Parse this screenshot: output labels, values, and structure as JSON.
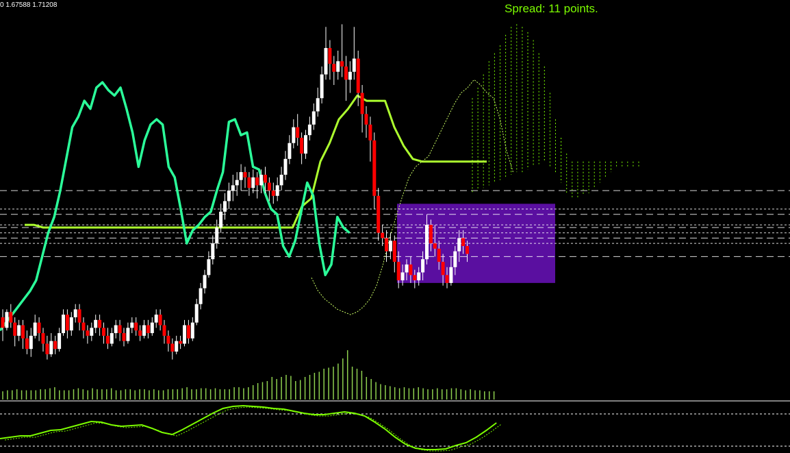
{
  "header": {
    "ohlc_readout": "0 1.67588 1.71208",
    "spread_text": "Spread: 11 points."
  },
  "colors": {
    "background": "#000000",
    "bull_candle": "#ffffff",
    "bear_candle": "#ff0000",
    "wick": "#ffffff",
    "tenkan": "#2bff9a",
    "kijun": "#adff2f",
    "chikou": "#ccff66",
    "cloud": "#7cfc00",
    "levels": "#ffffff",
    "zone_fill": "#5a0fa0",
    "volume": "#8fd14f",
    "oscillator": "#7cfc00",
    "spread_text": "#7cfc00"
  },
  "chart_data": [
    {
      "type": "candlestick",
      "candles_ohlc": [
        [
          1.665,
          1.661,
          1.668,
          1.656
        ],
        [
          1.661,
          1.667,
          1.668,
          1.66
        ],
        [
          1.667,
          1.663,
          1.67,
          1.661
        ],
        [
          1.663,
          1.658,
          1.665,
          1.654
        ],
        [
          1.658,
          1.662,
          1.664,
          1.656
        ],
        [
          1.662,
          1.657,
          1.664,
          1.653
        ],
        [
          1.657,
          1.653,
          1.66,
          1.651
        ],
        [
          1.653,
          1.658,
          1.661,
          1.65
        ],
        [
          1.658,
          1.663,
          1.666,
          1.657
        ],
        [
          1.663,
          1.659,
          1.665,
          1.656
        ],
        [
          1.659,
          1.655,
          1.661,
          1.652
        ],
        [
          1.655,
          1.651,
          1.658,
          1.649
        ],
        [
          1.651,
          1.656,
          1.659,
          1.65
        ],
        [
          1.656,
          1.653,
          1.658,
          1.651
        ],
        [
          1.653,
          1.659,
          1.661,
          1.652
        ],
        [
          1.659,
          1.666,
          1.668,
          1.658
        ],
        [
          1.666,
          1.66,
          1.668,
          1.657
        ],
        [
          1.66,
          1.665,
          1.667,
          1.658
        ],
        [
          1.665,
          1.668,
          1.67,
          1.663
        ],
        [
          1.668,
          1.663,
          1.67,
          1.66
        ],
        [
          1.663,
          1.66,
          1.665,
          1.657
        ],
        [
          1.66,
          1.658,
          1.662,
          1.655
        ],
        [
          1.658,
          1.661,
          1.663,
          1.656
        ],
        [
          1.661,
          1.664,
          1.666,
          1.659
        ],
        [
          1.664,
          1.661,
          1.666,
          1.658
        ],
        [
          1.661,
          1.658,
          1.663,
          1.655
        ],
        [
          1.658,
          1.655,
          1.661,
          1.653
        ],
        [
          1.655,
          1.659,
          1.661,
          1.654
        ],
        [
          1.659,
          1.662,
          1.664,
          1.657
        ],
        [
          1.662,
          1.659,
          1.664,
          1.656
        ],
        [
          1.659,
          1.656,
          1.661,
          1.654
        ],
        [
          1.656,
          1.661,
          1.663,
          1.655
        ],
        [
          1.661,
          1.663,
          1.665,
          1.659
        ],
        [
          1.663,
          1.66,
          1.665,
          1.658
        ],
        [
          1.66,
          1.658,
          1.662,
          1.656
        ],
        [
          1.658,
          1.662,
          1.664,
          1.657
        ],
        [
          1.662,
          1.659,
          1.664,
          1.657
        ],
        [
          1.659,
          1.663,
          1.665,
          1.658
        ],
        [
          1.663,
          1.666,
          1.668,
          1.661
        ],
        [
          1.666,
          1.662,
          1.668,
          1.66
        ],
        [
          1.662,
          1.658,
          1.664,
          1.655
        ],
        [
          1.658,
          1.655,
          1.66,
          1.652
        ],
        [
          1.655,
          1.652,
          1.657,
          1.649
        ],
        [
          1.652,
          1.656,
          1.658,
          1.651
        ],
        [
          1.656,
          1.655,
          1.658,
          1.653
        ],
        [
          1.655,
          1.662,
          1.664,
          1.654
        ],
        [
          1.662,
          1.657,
          1.664,
          1.655
        ],
        [
          1.657,
          1.663,
          1.665,
          1.656
        ],
        [
          1.663,
          1.67,
          1.672,
          1.662
        ],
        [
          1.67,
          1.676,
          1.678,
          1.668
        ],
        [
          1.676,
          1.681,
          1.683,
          1.674
        ],
        [
          1.681,
          1.687,
          1.69,
          1.68
        ],
        [
          1.687,
          1.693,
          1.696,
          1.685
        ],
        [
          1.693,
          1.699,
          1.702,
          1.691
        ],
        [
          1.699,
          1.705,
          1.708,
          1.697
        ],
        [
          1.705,
          1.709,
          1.712,
          1.702
        ],
        [
          1.709,
          1.713,
          1.716,
          1.706
        ],
        [
          1.713,
          1.715,
          1.719,
          1.709
        ],
        [
          1.715,
          1.717,
          1.72,
          1.711
        ],
        [
          1.717,
          1.72,
          1.723,
          1.713
        ],
        [
          1.72,
          1.718,
          1.722,
          1.714
        ],
        [
          1.718,
          1.714,
          1.72,
          1.711
        ],
        [
          1.714,
          1.718,
          1.721,
          1.712
        ],
        [
          1.718,
          1.715,
          1.72,
          1.71
        ],
        [
          1.715,
          1.719,
          1.721,
          1.712
        ],
        [
          1.719,
          1.716,
          1.722,
          1.712
        ],
        [
          1.716,
          1.713,
          1.718,
          1.709
        ],
        [
          1.713,
          1.711,
          1.716,
          1.708
        ],
        [
          1.711,
          1.715,
          1.718,
          1.709
        ],
        [
          1.715,
          1.719,
          1.722,
          1.713
        ],
        [
          1.719,
          1.725,
          1.728,
          1.717
        ],
        [
          1.725,
          1.731,
          1.734,
          1.723
        ],
        [
          1.731,
          1.737,
          1.74,
          1.729
        ],
        [
          1.737,
          1.733,
          1.742,
          1.73
        ],
        [
          1.733,
          1.727,
          1.735,
          1.723
        ],
        [
          1.727,
          1.734,
          1.736,
          1.725
        ],
        [
          1.734,
          1.738,
          1.741,
          1.732
        ],
        [
          1.738,
          1.743,
          1.746,
          1.736
        ],
        [
          1.743,
          1.748,
          1.752,
          1.741
        ],
        [
          1.748,
          1.757,
          1.76,
          1.746
        ],
        [
          1.757,
          1.767,
          1.775,
          1.755
        ],
        [
          1.767,
          1.761,
          1.77,
          1.755
        ],
        [
          1.761,
          1.758,
          1.764,
          1.753
        ],
        [
          1.758,
          1.762,
          1.766,
          1.755
        ],
        [
          1.762,
          1.76,
          1.776,
          1.756
        ],
        [
          1.76,
          1.755,
          1.764,
          1.747
        ],
        [
          1.755,
          1.758,
          1.762,
          1.75
        ],
        [
          1.758,
          1.763,
          1.775,
          1.755
        ],
        [
          1.763,
          1.75,
          1.766,
          1.745
        ],
        [
          1.75,
          1.742,
          1.753,
          1.735
        ],
        [
          1.742,
          1.738,
          1.745,
          1.733
        ],
        [
          1.738,
          1.732,
          1.741,
          1.724
        ],
        [
          1.732,
          1.711,
          1.735,
          1.706
        ],
        [
          1.711,
          1.697,
          1.714,
          1.694
        ],
        [
          1.697,
          1.695,
          1.7,
          1.692
        ],
        [
          1.695,
          1.69,
          1.698,
          1.686
        ],
        [
          1.69,
          1.694,
          1.697,
          1.687
        ],
        [
          1.694,
          1.686,
          1.696,
          1.682
        ],
        [
          1.686,
          1.679,
          1.69,
          1.676
        ],
        [
          1.679,
          1.682,
          1.685,
          1.677
        ],
        [
          1.682,
          1.685,
          1.687,
          1.679
        ],
        [
          1.685,
          1.681,
          1.688,
          1.678
        ],
        [
          1.681,
          1.679,
          1.683,
          1.676
        ],
        [
          1.679,
          1.682,
          1.684,
          1.677
        ],
        [
          1.682,
          1.687,
          1.69,
          1.679
        ],
        [
          1.687,
          1.7,
          1.704,
          1.685
        ],
        [
          1.7,
          1.693,
          1.702,
          1.69
        ],
        [
          1.693,
          1.691,
          1.7,
          1.688
        ],
        [
          1.691,
          1.686,
          1.694,
          1.683
        ],
        [
          1.686,
          1.681,
          1.689,
          1.677
        ],
        [
          1.681,
          1.678,
          1.684,
          1.676
        ],
        [
          1.678,
          1.684,
          1.688,
          1.677
        ],
        [
          1.684,
          1.69,
          1.692,
          1.681
        ],
        [
          1.69,
          1.695,
          1.698,
          1.686
        ],
        [
          1.695,
          1.692,
          1.698,
          1.689
        ],
        [
          1.692,
          1.689,
          1.694,
          1.686
        ]
      ],
      "ichimoku": {
        "tenkan": [
          1.66,
          1.663,
          1.666,
          1.669,
          1.672,
          1.675,
          1.679,
          1.688,
          1.697,
          1.703,
          1.713,
          1.725,
          1.737,
          1.741,
          1.747,
          1.744,
          1.752,
          1.754,
          1.751,
          1.749,
          1.752,
          1.744,
          1.735,
          1.722,
          1.732,
          1.738,
          1.74,
          1.738,
          1.722,
          1.718,
          1.706,
          1.693,
          1.698,
          1.7,
          1.703,
          1.705,
          1.713,
          1.72,
          1.739,
          1.74,
          1.734,
          1.735,
          1.722,
          1.721,
          1.712,
          1.706,
          1.704,
          1.692,
          1.688,
          1.694,
          1.705,
          1.716,
          1.711,
          1.693,
          1.681,
          1.685,
          1.703,
          1.699,
          1.697
        ],
        "kijun": [
          1.7,
          1.7,
          1.699,
          1.699,
          1.699,
          1.699,
          1.699,
          1.699,
          1.699,
          1.699,
          1.699,
          1.699,
          1.699,
          1.699,
          1.699,
          1.699,
          1.699,
          1.699,
          1.699,
          1.699,
          1.699,
          1.699,
          1.699,
          1.699,
          1.699,
          1.699,
          1.699,
          1.699,
          1.699,
          1.699,
          1.707,
          1.71,
          1.724,
          1.731,
          1.74,
          1.744,
          1.749,
          1.747,
          1.747,
          1.747,
          1.737,
          1.73,
          1.725,
          1.724,
          1.724,
          1.724,
          1.724,
          1.724,
          1.724,
          1.724,
          1.724
        ],
        "chikou": [
          1.68,
          1.675,
          1.672,
          1.67,
          1.668,
          1.667,
          1.666,
          1.667,
          1.669,
          1.672,
          1.677,
          1.685,
          1.695,
          1.703,
          1.711,
          1.718,
          1.722,
          1.724,
          1.726,
          1.731,
          1.736,
          1.741,
          1.746,
          1.75,
          1.752,
          1.755,
          1.753,
          1.75,
          1.748,
          1.74,
          1.728,
          1.72
        ]
      },
      "levels": [
        1.713,
        1.706,
        1.704,
        1.7,
        1.699,
        1.697,
        1.695,
        1.693,
        1.688
      ],
      "zone": {
        "price_top": 1.708,
        "price_bottom": 1.678
      },
      "volume": [
        8,
        9,
        9,
        10,
        9,
        9,
        9,
        9,
        10,
        10,
        11,
        12,
        9,
        9,
        9,
        10,
        11,
        10,
        9,
        11,
        10,
        10,
        10,
        11,
        9,
        9,
        10,
        10,
        9,
        10,
        10,
        9,
        10,
        9,
        9,
        10,
        10,
        10,
        11,
        12,
        10,
        10,
        11,
        11,
        10,
        11,
        10,
        10,
        10,
        12,
        12,
        11,
        12,
        14,
        16,
        17,
        18,
        22,
        20,
        22,
        24,
        23,
        18,
        19,
        22,
        24,
        26,
        27,
        30,
        31,
        32,
        35,
        40,
        48,
        32,
        30,
        28,
        22,
        20,
        17,
        15,
        14,
        13,
        12,
        11,
        12,
        11,
        11,
        12,
        11,
        10,
        10,
        11,
        10,
        10,
        11,
        11,
        10,
        9,
        10,
        9,
        9,
        8,
        8,
        8
      ]
    }
  ]
}
